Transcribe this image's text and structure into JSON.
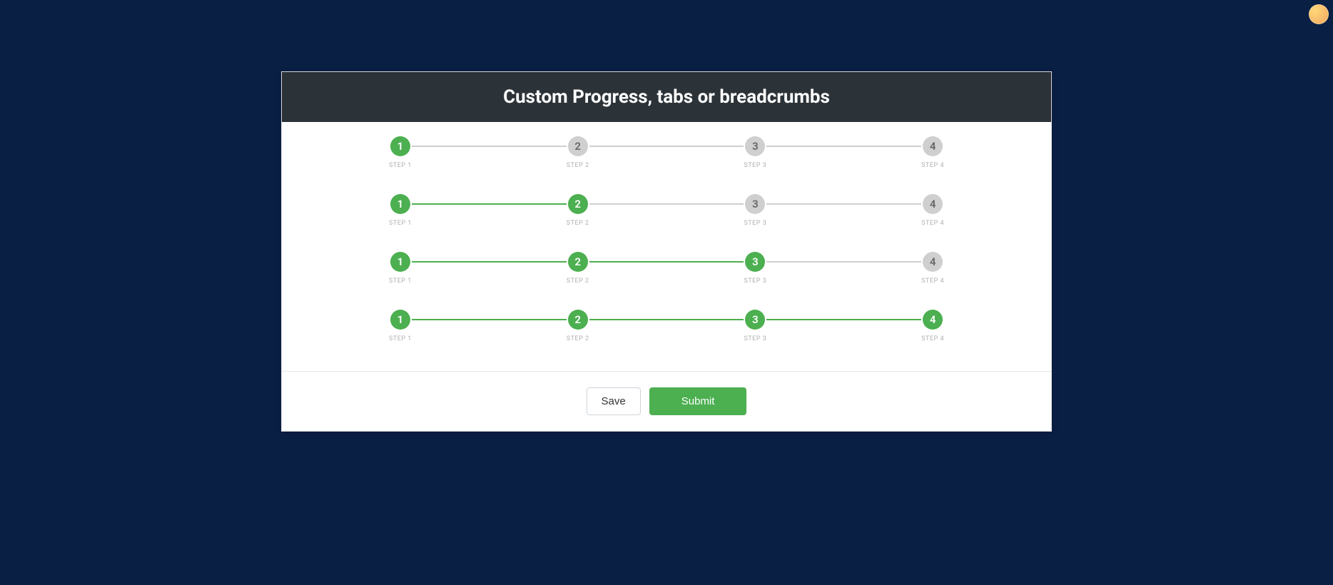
{
  "header": {
    "title": "Custom Progress, tabs or breadcrumbs"
  },
  "progress": {
    "steps": [
      {
        "num": "1",
        "label": "STEP 1"
      },
      {
        "num": "2",
        "label": "STEP 2"
      },
      {
        "num": "3",
        "label": "STEP 3"
      },
      {
        "num": "4",
        "label": "STEP 4"
      }
    ],
    "rows": [
      {
        "active_count": 1
      },
      {
        "active_count": 2
      },
      {
        "active_count": 3
      },
      {
        "active_count": 4
      }
    ]
  },
  "footer": {
    "save_label": "Save",
    "submit_label": "Submit"
  },
  "colors": {
    "background": "#0a1f44",
    "header_bg": "#2c3338",
    "active": "#4caf50",
    "inactive": "#cfcfcf"
  }
}
